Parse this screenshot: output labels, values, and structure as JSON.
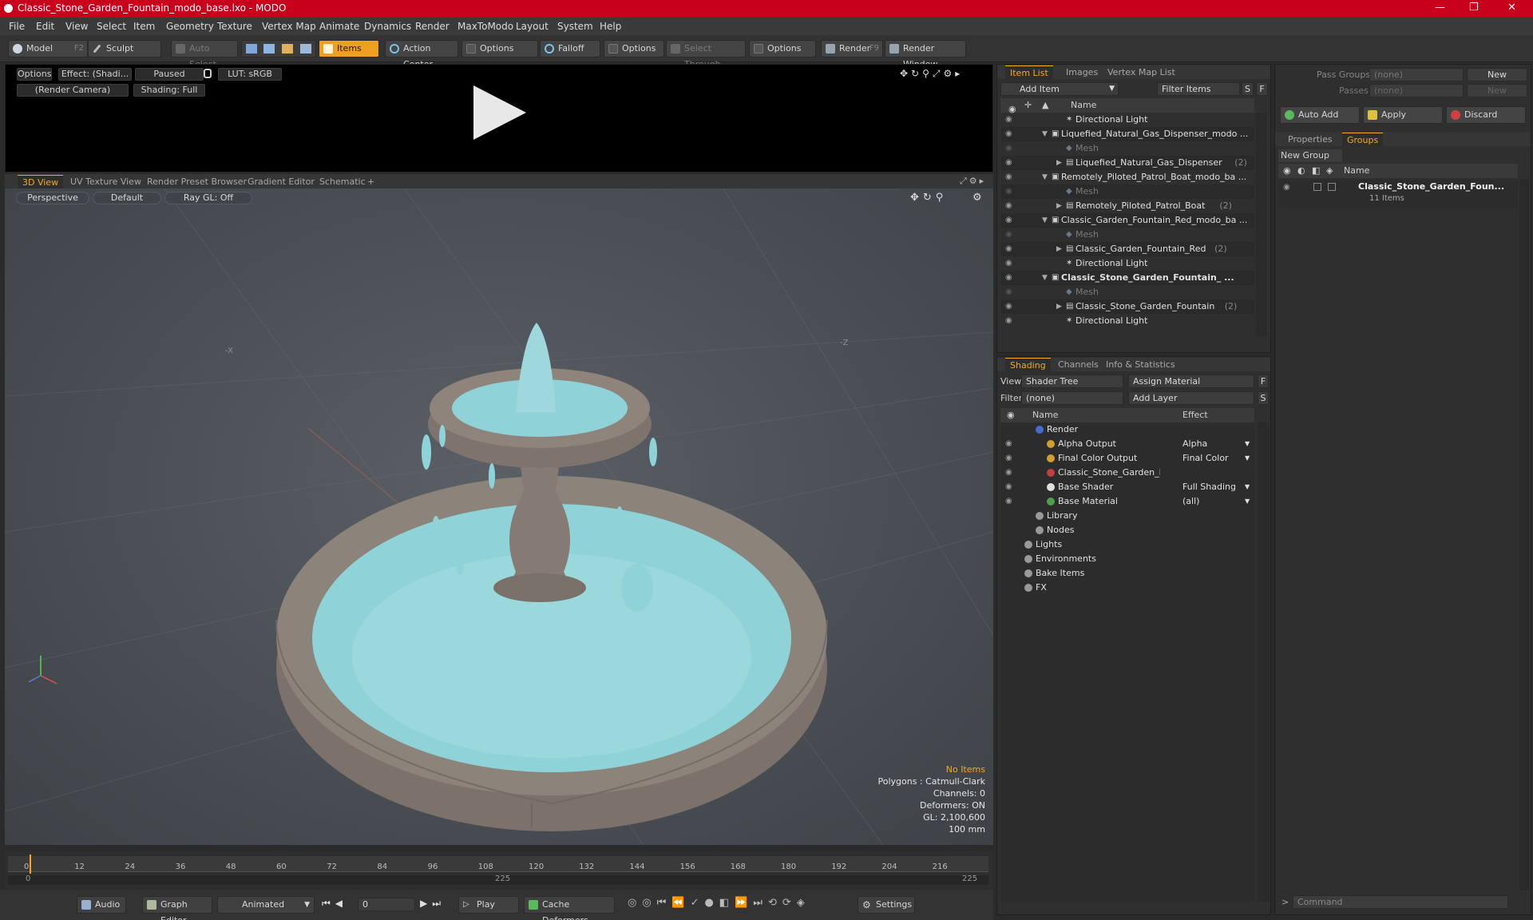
{
  "window": {
    "title": "Classic_Stone_Garden_Fountain_modo_base.lxo - MODO",
    "minimize": "—",
    "maximize": "❐",
    "close": "✕"
  },
  "menu": [
    "File",
    "Edit",
    "View",
    "Select",
    "Item",
    "Geometry",
    "Texture",
    "Vertex Map",
    "Animate",
    "Dynamics",
    "Render",
    "MaxToModo",
    "Layout",
    "System",
    "Help"
  ],
  "toolbar": {
    "model": "Model",
    "model_key": "F2",
    "sculpt": "Sculpt",
    "auto_select": "Auto Select",
    "items": "Items",
    "action_center": "Action Center",
    "options1": "Options",
    "falloff": "Falloff",
    "options2": "Options",
    "select_through": "Select Through",
    "options3": "Options",
    "render": "Render",
    "render_key": "F9",
    "render_window": "Render Window"
  },
  "render_preview": {
    "options": "Options",
    "effect": "Effect: (Shadi...",
    "paused": "Paused",
    "lut": "LUT: sRGB",
    "camera": "(Render Camera)",
    "shading": "Shading: Full"
  },
  "view_tabs": [
    "3D View",
    "UV Texture View",
    "Render Preset Browser",
    "Gradient Editor",
    "Schematic"
  ],
  "view_tabs_add": "+",
  "viewport": {
    "projection": "Perspective",
    "style": "Default",
    "raygl": "Ray GL: Off",
    "axis_minus_x": "-X",
    "axis_minus_z": "-Z",
    "info": {
      "no_items": "No Items",
      "polygons": "Polygons : Catmull-Clark",
      "channels": "Channels: 0",
      "deformers": "Deformers: ON",
      "gl": "GL: 2,100,600",
      "unit": "100 mm"
    },
    "colors": {
      "water": "#8fd3d8",
      "stone": "#8a7f78",
      "info_accent": "#f5a623"
    }
  },
  "timeline": {
    "ticks": [
      "0",
      "12",
      "24",
      "36",
      "48",
      "60",
      "72",
      "84",
      "96",
      "108",
      "120",
      "132",
      "144",
      "156",
      "168",
      "180",
      "192",
      "204",
      "216"
    ],
    "range_start": "0",
    "range_mid": "225",
    "range_end": "225"
  },
  "bottombar": {
    "audio": "Audio",
    "graph_editor": "Graph Editor",
    "animated": "Animated",
    "frame": "0",
    "play": "Play",
    "cache_deformers": "Cache Deformers",
    "settings": "Settings"
  },
  "item_list": {
    "tabs": [
      "Item List",
      "Images",
      "Vertex Map List"
    ],
    "add_item": "Add Item",
    "filter_items": "Filter Items",
    "s": "S",
    "f": "F",
    "col_name": "Name",
    "rows": [
      {
        "label": "Directional Light",
        "indent": 2,
        "kind": "light",
        "dim": false,
        "bold": false,
        "count": ""
      },
      {
        "label": "Liquefied_Natural_Gas_Dispenser_modo ...",
        "indent": 1,
        "kind": "scene",
        "dim": false,
        "bold": false,
        "count": ""
      },
      {
        "label": "Mesh",
        "indent": 2,
        "kind": "mesh",
        "dim": true,
        "bold": false,
        "count": ""
      },
      {
        "label": "Liquefied_Natural_Gas_Dispenser",
        "indent": 2,
        "kind": "group",
        "dim": false,
        "bold": false,
        "count": "(2)"
      },
      {
        "label": "Remotely_Piloted_Patrol_Boat_modo_ba ...",
        "indent": 1,
        "kind": "scene",
        "dim": false,
        "bold": false,
        "count": ""
      },
      {
        "label": "Mesh",
        "indent": 2,
        "kind": "mesh",
        "dim": true,
        "bold": false,
        "count": ""
      },
      {
        "label": "Remotely_Piloted_Patrol_Boat",
        "indent": 2,
        "kind": "group",
        "dim": false,
        "bold": false,
        "count": "(2)"
      },
      {
        "label": "Classic_Garden_Fountain_Red_modo_ba ...",
        "indent": 1,
        "kind": "scene",
        "dim": false,
        "bold": false,
        "count": ""
      },
      {
        "label": "Mesh",
        "indent": 2,
        "kind": "mesh",
        "dim": true,
        "bold": false,
        "count": ""
      },
      {
        "label": "Classic_Garden_Fountain_Red",
        "indent": 2,
        "kind": "group",
        "dim": false,
        "bold": false,
        "count": "(2)"
      },
      {
        "label": "Directional Light",
        "indent": 2,
        "kind": "light",
        "dim": false,
        "bold": false,
        "count": ""
      },
      {
        "label": "Classic_Stone_Garden_Fountain_ ...",
        "indent": 1,
        "kind": "scene",
        "dim": false,
        "bold": true,
        "count": ""
      },
      {
        "label": "Mesh",
        "indent": 2,
        "kind": "mesh",
        "dim": true,
        "bold": false,
        "count": ""
      },
      {
        "label": "Classic_Stone_Garden_Fountain",
        "indent": 2,
        "kind": "group",
        "dim": false,
        "bold": false,
        "count": "(2)"
      },
      {
        "label": "Directional Light",
        "indent": 2,
        "kind": "light",
        "dim": false,
        "bold": false,
        "count": ""
      }
    ]
  },
  "shading": {
    "tabs": [
      "Shading",
      "Channels",
      "Info & Statistics"
    ],
    "view_label": "View",
    "view_value": "Shader Tree",
    "assign_material": "Assign Material",
    "filter_label": "Filter",
    "filter_value": "(none)",
    "add_layer": "Add Layer",
    "f": "F",
    "s": "S",
    "col_name": "Name",
    "col_effect": "Effect",
    "rows": [
      {
        "label": "Render",
        "effect": "",
        "indent": 1,
        "eye": false
      },
      {
        "label": "Alpha Output",
        "effect": "Alpha",
        "indent": 2,
        "eye": true
      },
      {
        "label": "Final Color Output",
        "effect": "Final Color",
        "indent": 2,
        "eye": true
      },
      {
        "label": "Classic_Stone_Garden_Fou...",
        "effect": "",
        "indent": 2,
        "eye": true
      },
      {
        "label": "Base Shader",
        "effect": "Full Shading",
        "indent": 2,
        "eye": true
      },
      {
        "label": "Base Material",
        "effect": "(all)",
        "indent": 2,
        "eye": true
      },
      {
        "label": "Library",
        "effect": "",
        "indent": 1,
        "eye": false
      },
      {
        "label": "Nodes",
        "effect": "",
        "indent": 1,
        "eye": false
      },
      {
        "label": "Lights",
        "effect": "",
        "indent": 0,
        "eye": false
      },
      {
        "label": "Environments",
        "effect": "",
        "indent": 0,
        "eye": false
      },
      {
        "label": "Bake Items",
        "effect": "",
        "indent": 0,
        "eye": false
      },
      {
        "label": "FX",
        "effect": "",
        "indent": 0,
        "eye": false
      }
    ]
  },
  "groups": {
    "pass_groups_label": "Pass Groups",
    "pass_groups_value": "(none)",
    "new1": "New",
    "passes_label": "Passes",
    "passes_value": "(none)",
    "new2": "New",
    "auto_add": "Auto Add",
    "apply": "Apply",
    "discard": "Discard",
    "tabs": [
      "Properties",
      "Groups"
    ],
    "new_group": "New Group",
    "col_name": "Name",
    "group_name": "Classic_Stone_Garden_Foun...",
    "group_count": "11 Items",
    "command_placeholder": "Command"
  }
}
